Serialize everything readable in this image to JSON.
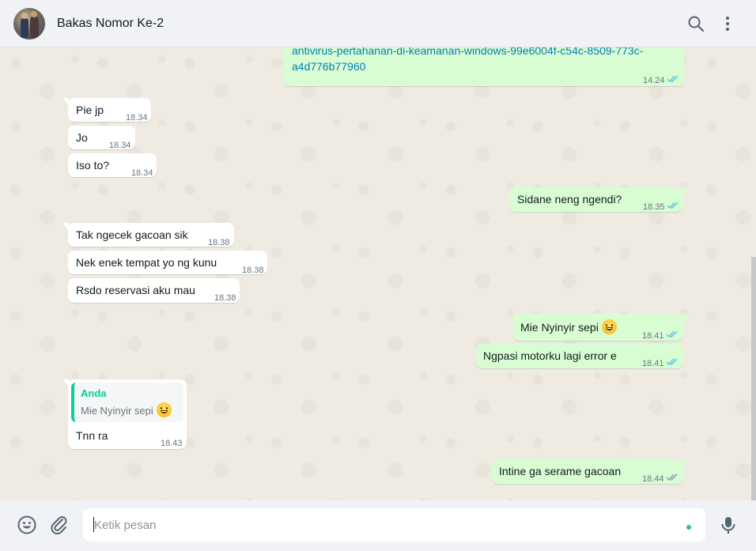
{
  "header": {
    "title": "Bakas Nomor Ke-2",
    "search_icon": "search-icon",
    "menu_icon": "menu-icon"
  },
  "messages": [
    {
      "dir": "out",
      "text": "https://support.microsoft.com/id-id/windows/menonaktifkan-proteksi-antivirus-pertahanan-di-keamanan-windows-99e6004f-c54c-8509-773c-a4d776b77960",
      "text_visible": "antivirus-pertahanan-di-keamanan-windows-99e6004f-c54c-8509-773c-a4d776b77960",
      "time": "14.24",
      "status": "read"
    },
    {
      "dir": "in",
      "text": "Pie jp",
      "time": "18.34"
    },
    {
      "dir": "in",
      "text": "Jo",
      "time": "18.34"
    },
    {
      "dir": "in",
      "text": "Iso to?",
      "time": "18.34"
    },
    {
      "dir": "out",
      "text": "Sidane neng ngendi?",
      "time": "18.35",
      "status": "read"
    },
    {
      "dir": "in",
      "text": "Tak ngecek gacoan sik",
      "time": "18.38"
    },
    {
      "dir": "in",
      "text": "Nek enek tempat yo ng kunu",
      "time": "18.38"
    },
    {
      "dir": "in",
      "text": "Rsdo reservasi aku mau",
      "time": "18.38"
    },
    {
      "dir": "out",
      "text": "Mie Nyinyir sepi",
      "time": "18.41",
      "status": "read",
      "emoji": "grinning-face"
    },
    {
      "dir": "out",
      "text": "Ngpasi motorku lagi error e",
      "time": "18.41",
      "status": "read"
    },
    {
      "dir": "in",
      "quote_author": "Anda",
      "quote_text": "Mie Nyinyir sepi",
      "text": "Tnn ra",
      "time": "18.43"
    },
    {
      "dir": "out",
      "text": "Intine ga serame gacoan",
      "time": "18.44",
      "status": "delivered"
    }
  ],
  "composer": {
    "placeholder": "Ketik pesan",
    "emoji_icon": "emoji-icon",
    "attach_icon": "paperclip-icon",
    "mic_icon": "microphone-icon"
  },
  "colors": {
    "outgoing_bubble": "#d9fdd3",
    "incoming_bubble": "#ffffff",
    "read_ticks": "#53bdeb",
    "quote_accent": "#06cf9c",
    "link": "#027eb5"
  }
}
